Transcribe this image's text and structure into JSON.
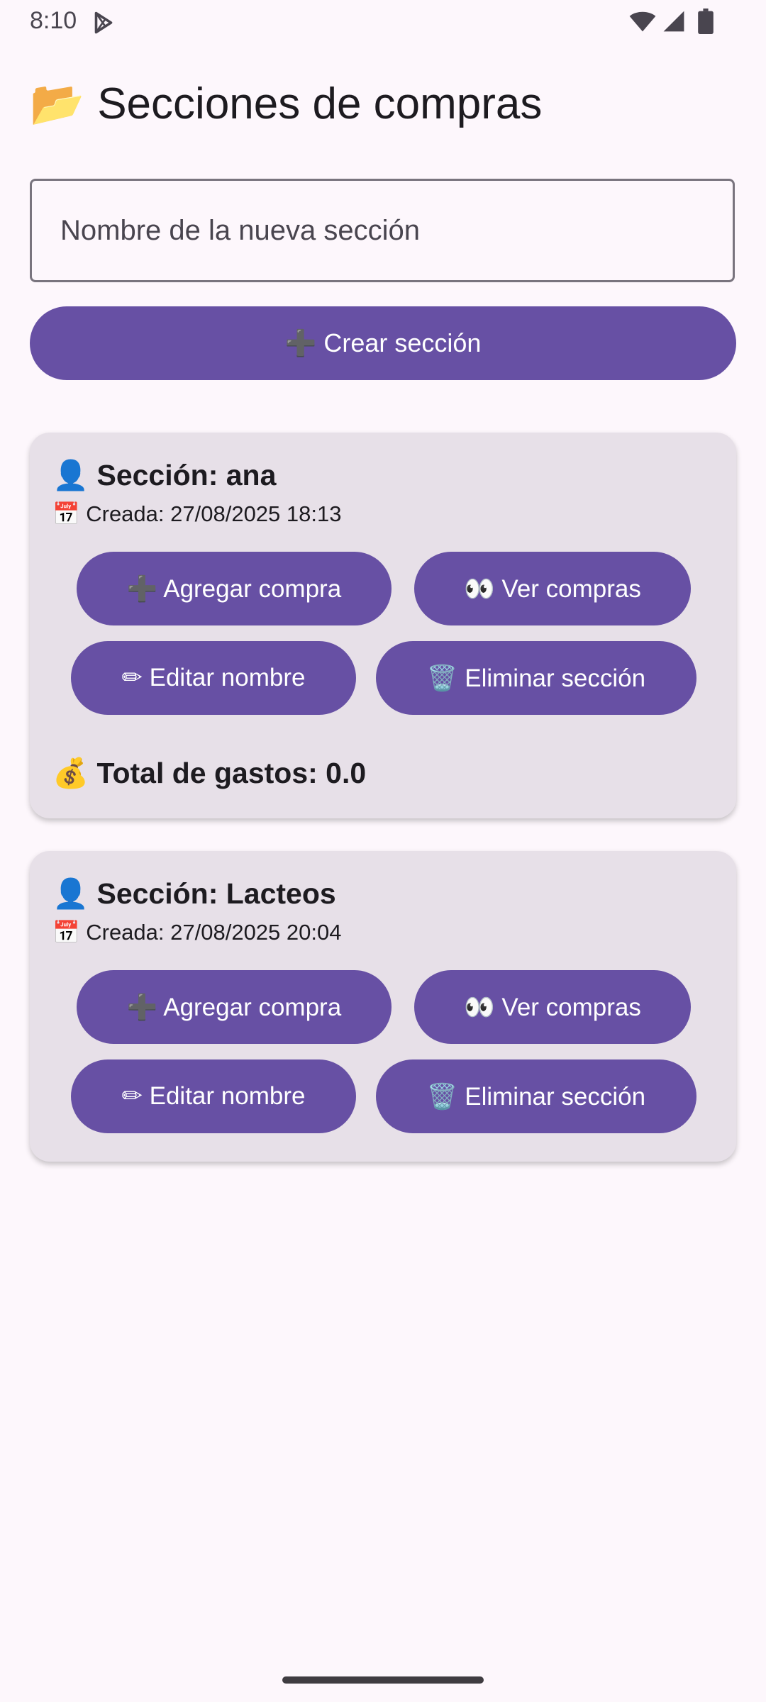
{
  "status_bar": {
    "time": "8:10",
    "icons": [
      "play-store-icon",
      "wifi-icon",
      "cell-signal-icon",
      "battery-icon"
    ]
  },
  "header": {
    "icon": "📂",
    "icon_name": "open-folder-icon",
    "title": "Secciones de compras"
  },
  "new_section": {
    "placeholder": "Nombre de la nueva sección",
    "value": "",
    "create_icon": "➕",
    "create_label": "Crear sección"
  },
  "sections": [
    {
      "user_icon": "👤",
      "title": "Sección: ana",
      "calendar_icon": "📅",
      "created": "Creada: 27/08/2025 18:13",
      "add_icon": "➕",
      "add_label": "Agregar compra",
      "view_icon": "👀",
      "view_label": "Ver compras",
      "edit_icon": "✏",
      "edit_label": "Editar nombre",
      "delete_icon": "🗑️",
      "delete_label": "Eliminar sección",
      "total_icon": "💰",
      "total": "Total de gastos: 0.0"
    },
    {
      "user_icon": "👤",
      "title": "Sección: Lacteos",
      "calendar_icon": "📅",
      "created": "Creada: 27/08/2025 20:04",
      "add_icon": "➕",
      "add_label": "Agregar compra",
      "view_icon": "👀",
      "view_label": "Ver compras",
      "edit_icon": "✏",
      "edit_label": "Editar nombre",
      "delete_icon": "🗑️",
      "delete_label": "Eliminar sección"
    }
  ],
  "colors": {
    "background": "#fdf7fc",
    "primary": "#6750a4",
    "card": "#e7e0e8",
    "text": "#1d1b20"
  }
}
